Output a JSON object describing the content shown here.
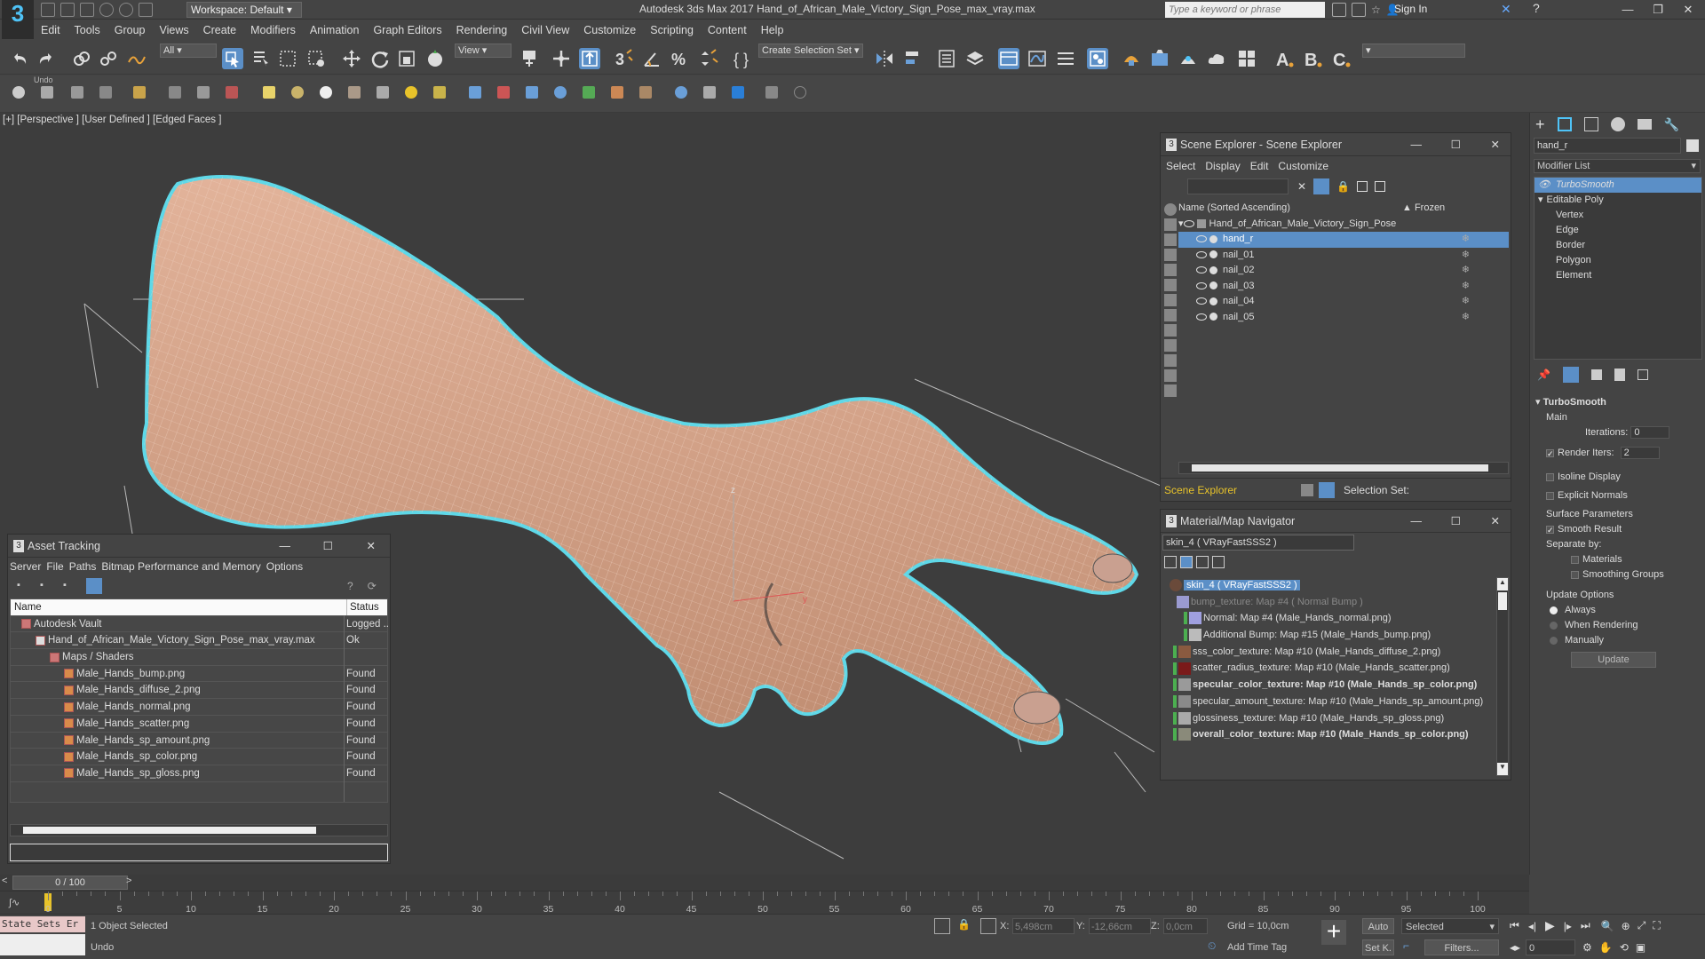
{
  "title_bar": {
    "workspace": "Workspace: Default",
    "app_title": "Autodesk 3ds Max 2017      Hand_of_African_Male_Victory_Sign_Pose_max_vray.max",
    "search_placeholder": "Type a keyword or phrase",
    "sign_in": "Sign In"
  },
  "menu": [
    "Edit",
    "Tools",
    "Group",
    "Views",
    "Create",
    "Modifiers",
    "Animation",
    "Graph Editors",
    "Rendering",
    "Civil View",
    "Customize",
    "Scripting",
    "Content",
    "Help"
  ],
  "main_toolbar": {
    "filter_dropdown": "All",
    "refcoord_dropdown": "View",
    "selection_set": "Create Selection Set",
    "undo_tooltip": "Undo"
  },
  "viewport": {
    "label": "[+] [Perspective ] [User Defined ] [Edged Faces ]",
    "axis_z": "z",
    "axis_y": "y"
  },
  "scene_explorer": {
    "title": "Scene Explorer - Scene Explorer",
    "menus": [
      "Select",
      "Display",
      "Edit",
      "Customize"
    ],
    "col_name": "Name (Sorted Ascending)",
    "col_frozen": "▲ Frozen",
    "root": "Hand_of_African_Male_Victory_Sign_Pose",
    "items": [
      "hand_r",
      "nail_01",
      "nail_02",
      "nail_03",
      "nail_04",
      "nail_05"
    ],
    "footer_dropdown": "Scene Explorer",
    "selection_set_label": "Selection Set:"
  },
  "asset_tracking": {
    "title": "Asset Tracking",
    "menus": [
      "Server",
      "File",
      "Paths",
      "Bitmap Performance and Memory",
      "Options"
    ],
    "col_name": "Name",
    "col_status": "Status",
    "rows": [
      {
        "name": "Autodesk Vault",
        "status": "Logged ..",
        "indent": 0,
        "icon": "vault"
      },
      {
        "name": "Hand_of_African_Male_Victory_Sign_Pose_max_vray.max",
        "status": "Ok",
        "indent": 1,
        "icon": "max"
      },
      {
        "name": "Maps / Shaders",
        "status": "",
        "indent": 2,
        "icon": "folder"
      },
      {
        "name": "Male_Hands_bump.png",
        "status": "Found",
        "indent": 3,
        "icon": "file"
      },
      {
        "name": "Male_Hands_diffuse_2.png",
        "status": "Found",
        "indent": 3,
        "icon": "file"
      },
      {
        "name": "Male_Hands_normal.png",
        "status": "Found",
        "indent": 3,
        "icon": "file"
      },
      {
        "name": "Male_Hands_scatter.png",
        "status": "Found",
        "indent": 3,
        "icon": "file"
      },
      {
        "name": "Male_Hands_sp_amount.png",
        "status": "Found",
        "indent": 3,
        "icon": "file"
      },
      {
        "name": "Male_Hands_sp_color.png",
        "status": "Found",
        "indent": 3,
        "icon": "file"
      },
      {
        "name": "Male_Hands_sp_gloss.png",
        "status": "Found",
        "indent": 3,
        "icon": "file"
      }
    ]
  },
  "material_navigator": {
    "title": "Material/Map Navigator",
    "material_field": "skin_4  ( VRayFastSSS2 )",
    "rows": [
      {
        "text": "skin_4  ( VRayFastSSS2 )",
        "indent": 0,
        "swatch": "#6a4a3a",
        "style": "selected"
      },
      {
        "text": "bump_texture: Map #4  ( Normal Bump )",
        "indent": 1,
        "swatch": "#9a9ad0",
        "style": "dim"
      },
      {
        "text": "Normal: Map #4 (Male_Hands_normal.png)",
        "indent": 2,
        "swatch": "#a0a0e0",
        "style": "normal"
      },
      {
        "text": "Additional Bump: Map #15 (Male_Hands_bump.png)",
        "indent": 2,
        "swatch": "#bbbbbb",
        "style": "normal"
      },
      {
        "text": "sss_color_texture: Map #10 (Male_Hands_diffuse_2.png)",
        "indent": 1,
        "swatch": "#8a5a40",
        "style": "normal"
      },
      {
        "text": "scatter_radius_texture: Map #10 (Male_Hands_scatter.png)",
        "indent": 1,
        "swatch": "#7a1a1a",
        "style": "normal"
      },
      {
        "text": "specular_color_texture: Map #10 (Male_Hands_sp_color.png)",
        "indent": 1,
        "swatch": "#9a9a9a",
        "style": "bold"
      },
      {
        "text": "specular_amount_texture: Map #10 (Male_Hands_sp_amount.png)",
        "indent": 1,
        "swatch": "#8a8a8a",
        "style": "normal"
      },
      {
        "text": "glossiness_texture: Map #10 (Male_Hands_sp_gloss.png)",
        "indent": 1,
        "swatch": "#aaaaaa",
        "style": "normal"
      },
      {
        "text": "overall_color_texture: Map #10 (Male_Hands_sp_color.png)",
        "indent": 1,
        "swatch": "#8a8a7a",
        "style": "bold"
      }
    ]
  },
  "command_panel": {
    "object_name": "hand_r",
    "modifier_list": "Modifier List",
    "stack": [
      "TurboSmooth",
      "Editable Poly",
      "Vertex",
      "Edge",
      "Border",
      "Polygon",
      "Element"
    ],
    "turbosmooth": {
      "title": "TurboSmooth",
      "main": "Main",
      "iterations_label": "Iterations:",
      "iterations": "0",
      "render_iters_label": "Render Iters:",
      "render_iters": "2",
      "isoline": "Isoline Display",
      "explicit_normals": "Explicit Normals",
      "surface_params": "Surface Parameters",
      "smooth_result": "Smooth Result",
      "separate_by": "Separate by:",
      "materials": "Materials",
      "smoothing_groups": "Smoothing Groups",
      "update_options": "Update Options",
      "always": "Always",
      "when_rendering": "When Rendering",
      "manually": "Manually",
      "update_btn": "Update"
    }
  },
  "timeline": {
    "frame": "0 / 100",
    "ticks": [
      "0",
      "5",
      "10",
      "15",
      "20",
      "25",
      "30",
      "35",
      "40",
      "45",
      "50",
      "55",
      "60",
      "65",
      "70",
      "75",
      "80",
      "85",
      "90",
      "95",
      "100"
    ]
  },
  "status": {
    "maxscript": "State Sets Er",
    "selected": "1 Object Selected",
    "prompt": "Undo",
    "x_label": "X:",
    "x": "5,498cm",
    "y_label": "Y:",
    "y": "-12,66cm",
    "z_label": "Z:",
    "z": "0,0cm",
    "grid": "Grid = 10,0cm",
    "add_time_tag": "Add Time Tag",
    "auto": "Auto",
    "selected_dd": "Selected",
    "set_key": "Set K.",
    "filters": "Filters...",
    "frame_field": "0"
  },
  "colors": {
    "accent": "#5b8fc7",
    "selection_outline": "#5ed8e8",
    "skin": "#d9a487"
  }
}
